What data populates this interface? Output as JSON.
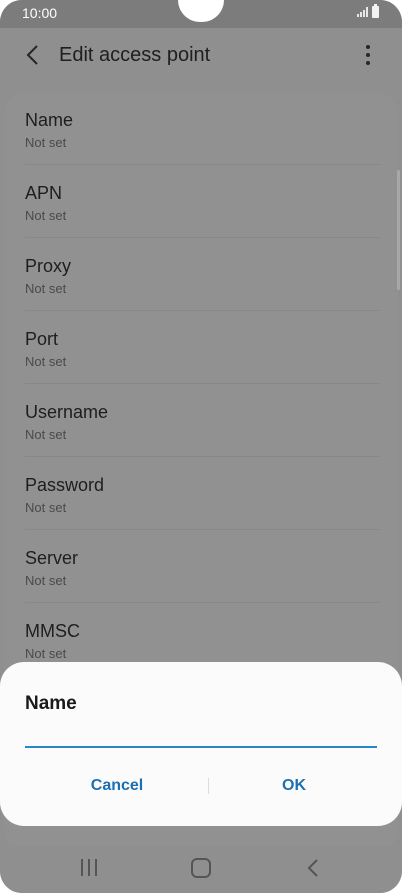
{
  "status_bar": {
    "time": "10:00"
  },
  "app_bar": {
    "title": "Edit access point"
  },
  "items": [
    {
      "title": "Name",
      "value": "Not set"
    },
    {
      "title": "APN",
      "value": "Not set"
    },
    {
      "title": "Proxy",
      "value": "Not set"
    },
    {
      "title": "Port",
      "value": "Not set"
    },
    {
      "title": "Username",
      "value": "Not set"
    },
    {
      "title": "Password",
      "value": "Not set"
    },
    {
      "title": "Server",
      "value": "Not set"
    },
    {
      "title": "MMSC",
      "value": "Not set"
    }
  ],
  "dialog": {
    "title": "Name",
    "input_value": "",
    "cancel_label": "Cancel",
    "ok_label": "OK"
  },
  "colors": {
    "accent": "#1c6fb2",
    "input_underline": "#2a86c4",
    "scrim": "#8f8f8f"
  },
  "icons": {
    "back": "back-arrow-icon",
    "more": "more-vert-icon",
    "signal": "signal-icon",
    "battery": "battery-icon",
    "nav_recent": "recent-apps-icon",
    "nav_home": "home-icon",
    "nav_back": "nav-back-icon"
  }
}
